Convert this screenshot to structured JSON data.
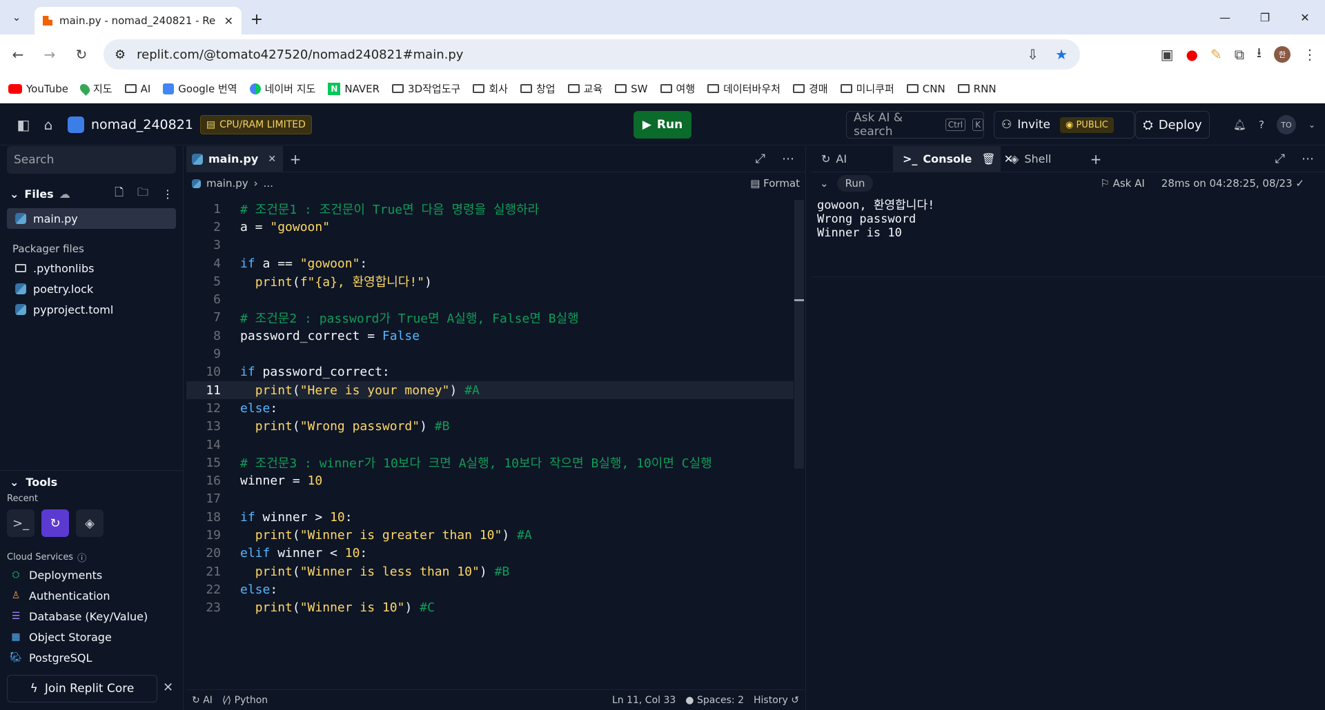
{
  "browser": {
    "tab_title": "main.py - nomad_240821 - Re",
    "url": "replit.com/@tomato427520/nomad240821#main.py",
    "bookmarks": [
      "YouTube",
      "지도",
      "AI",
      "Google 번역",
      "네이버 지도",
      "NAVER",
      "3D작업도구",
      "회사",
      "창업",
      "교육",
      "SW",
      "여행",
      "데이터바우처",
      "경매",
      "미니쿠퍼",
      "CNN",
      "RNN"
    ],
    "profile_initial": "한"
  },
  "topbar": {
    "repl_name": "nomad_240821",
    "limit_badge": "CPU/RAM LIMITED",
    "run_label": "Run",
    "search_label": "Ask AI & search",
    "kbd1": "Ctrl",
    "kbd2": "K",
    "invite_label": "Invite",
    "public_label": "PUBLIC",
    "deploy_label": "Deploy",
    "avatar": "TO"
  },
  "sidebar": {
    "search_placeholder": "Search",
    "files_label": "Files",
    "files": [
      {
        "name": "main.py",
        "type": "python"
      }
    ],
    "packager_label": "Packager files",
    "packager_files": [
      {
        "name": ".pythonlibs",
        "type": "folder"
      },
      {
        "name": "poetry.lock",
        "type": "python"
      },
      {
        "name": "pyproject.toml",
        "type": "python"
      }
    ],
    "tools_label": "Tools",
    "recent_label": "Recent",
    "cloud_label": "Cloud Services",
    "services": [
      "Deployments",
      "Authentication",
      "Database (Key/Value)",
      "Object Storage",
      "PostgreSQL"
    ],
    "join_label": "Join Replit Core"
  },
  "editor": {
    "tab": "main.py",
    "crumb": "main.py",
    "crumb_more": "...",
    "format_label": "Format",
    "current_line": 11,
    "lines": [
      "# 조건문1 : 조건문이 True면 다음 명령을 실행하라",
      "a = \"gowoon\"",
      "",
      "if a == \"gowoon\":",
      "  print(f\"{a}, 환영합니다!\")",
      "",
      "# 조건문2 : password가 True면 A실행, False면 B실행",
      "password_correct = False",
      "",
      "if password_correct:",
      "  print(\"Here is your money\") #A",
      "else:",
      "  print(\"Wrong password\") #B",
      "",
      "# 조건문3 : winner가 10보다 크면 A실행, 10보다 작으면 B실행, 10이면 C실행",
      "winner = 10",
      "",
      "if winner > 10:",
      "  print(\"Winner is greater than 10\") #A",
      "elif winner < 10:",
      "  print(\"Winner is less than 10\") #B",
      "else:",
      "  print(\"Winner is 10\") #C"
    ],
    "status_ai": "AI",
    "status_lang": "Python",
    "status_pos": "Ln 11, Col 33",
    "status_spaces": "Spaces: 2",
    "status_history": "History"
  },
  "console": {
    "tabs": [
      "AI",
      "Console",
      "Shell"
    ],
    "run_label": "Run",
    "ask_ai": "Ask AI",
    "timing": "28ms on 04:28:25, 08/23",
    "output": [
      "gowoon, 환영합니다!",
      "Wrong password",
      "Winner is 10"
    ]
  }
}
